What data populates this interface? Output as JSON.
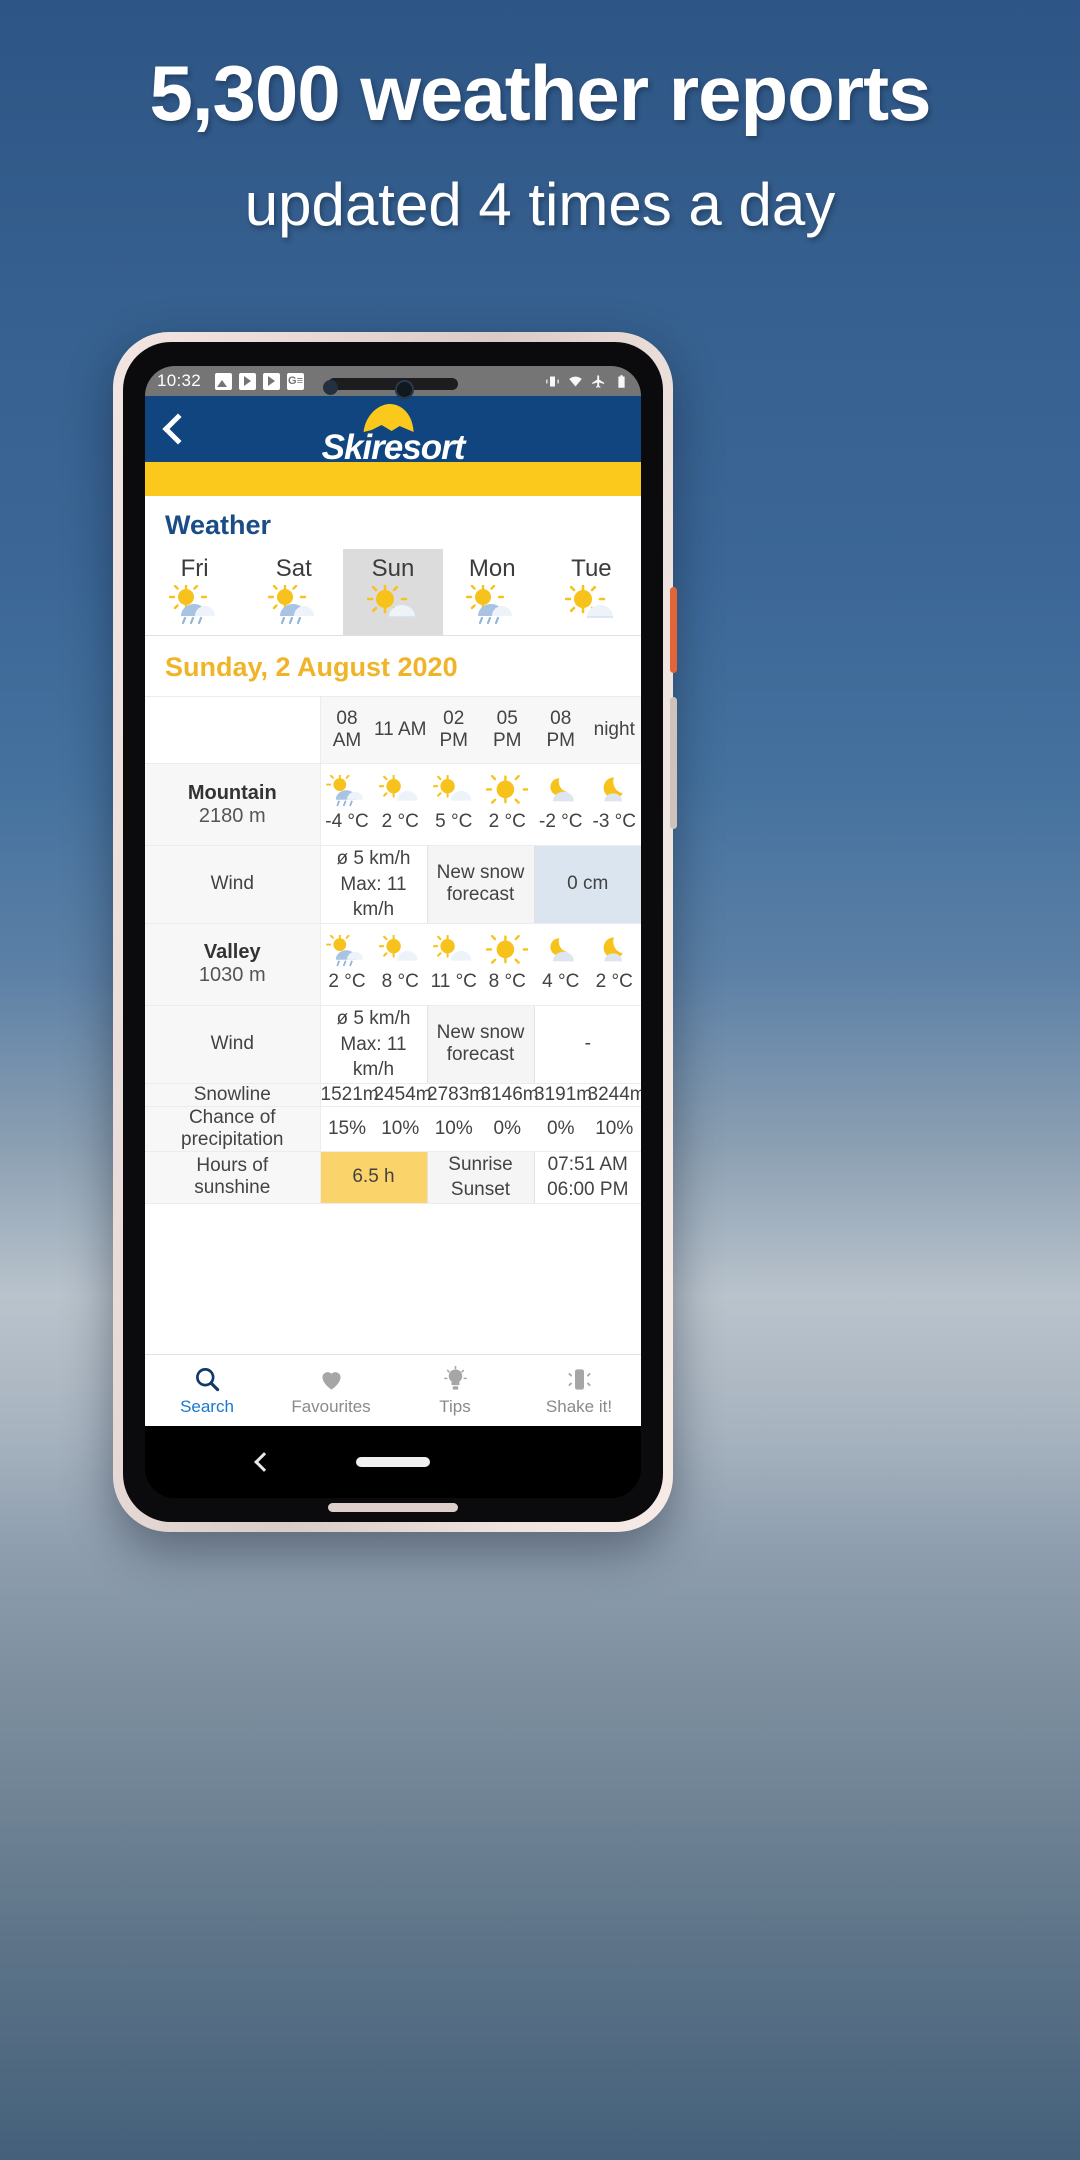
{
  "promo": {
    "title": "5,300 weather reports",
    "subtitle": "updated 4 times a day"
  },
  "status_bar": {
    "time": "10:32",
    "left_icons": [
      "image-icon",
      "play-icon",
      "play-icon",
      "google-news-icon"
    ],
    "right_icons": [
      "vibrate-icon",
      "wifi-icon",
      "airplane-mode-icon",
      "battery-icon"
    ]
  },
  "app_header": {
    "back_label": "",
    "logo_text": "Skiresort"
  },
  "section": {
    "title": "Weather",
    "date": "Sunday, 2 August 2020"
  },
  "day_tabs": [
    {
      "label": "Fri",
      "icon": "sun-cloud-rain-icon",
      "selected": false
    },
    {
      "label": "Sat",
      "icon": "sun-cloud-rain-icon",
      "selected": false
    },
    {
      "label": "Sun",
      "icon": "sun-cloud-icon",
      "selected": true
    },
    {
      "label": "Mon",
      "icon": "sun-cloud-rain-icon",
      "selected": false
    },
    {
      "label": "Tue",
      "icon": "sun-cloud-icon",
      "selected": false
    }
  ],
  "time_slots": [
    "08 AM",
    "11 AM",
    "02 PM",
    "05 PM",
    "08 PM",
    "night"
  ],
  "mountain": {
    "label": "Mountain",
    "altitude": "2180 m",
    "temps": [
      "-4 °C",
      "2 °C",
      "5 °C",
      "2 °C",
      "-2 °C",
      "-3 °C"
    ],
    "icons": [
      "sun-cloud-rain-icon",
      "sun-cloud-icon",
      "sun-cloud-icon",
      "sun-icon",
      "moon-cloud-icon",
      "moon-cloud-icon"
    ],
    "wind_label": "Wind",
    "wind_avg": "ø 5 km/h",
    "wind_max": "Max: 11 km/h",
    "new_snow_label": "New snow forecast",
    "new_snow_value": "0 cm"
  },
  "valley": {
    "label": "Valley",
    "altitude": "1030 m",
    "temps": [
      "2 °C",
      "8 °C",
      "11 °C",
      "8 °C",
      "4 °C",
      "2 °C"
    ],
    "icons": [
      "sun-cloud-rain-icon",
      "sun-cloud-icon",
      "sun-cloud-icon",
      "sun-icon",
      "moon-cloud-icon",
      "moon-cloud-icon"
    ],
    "wind_label": "Wind",
    "wind_avg": "ø 5 km/h",
    "wind_max": "Max: 11 km/h",
    "new_snow_label": "New snow forecast",
    "new_snow_value": "-"
  },
  "snowline": {
    "label": "Snowline",
    "values": [
      "1521m",
      "2454m",
      "2783m",
      "3146m",
      "3191m",
      "3244m"
    ]
  },
  "precipitation": {
    "label_line1": "Chance of",
    "label_line2": "precipitation",
    "values": [
      "15%",
      "10%",
      "10%",
      "0%",
      "0%",
      "10%"
    ]
  },
  "sunshine": {
    "label_line1": "Hours of",
    "label_line2": "sunshine",
    "value": "6.5 h",
    "sunrise_label": "Sunrise",
    "sunset_label": "Sunset",
    "sunrise_time": "07:51 AM",
    "sunset_time": "06:00 PM"
  },
  "bottom_nav": [
    {
      "label": "Search",
      "icon": "search-icon",
      "active": true
    },
    {
      "label": "Favourites",
      "icon": "heart-icon",
      "active": false
    },
    {
      "label": "Tips",
      "icon": "lightbulb-icon",
      "active": false
    },
    {
      "label": "Shake it!",
      "icon": "shake-icon",
      "active": false
    }
  ],
  "colors": {
    "brand_blue": "#11457f",
    "brand_yellow": "#fbc91b",
    "date_gold": "#f0b429",
    "accent_blue": "#1877d2"
  }
}
